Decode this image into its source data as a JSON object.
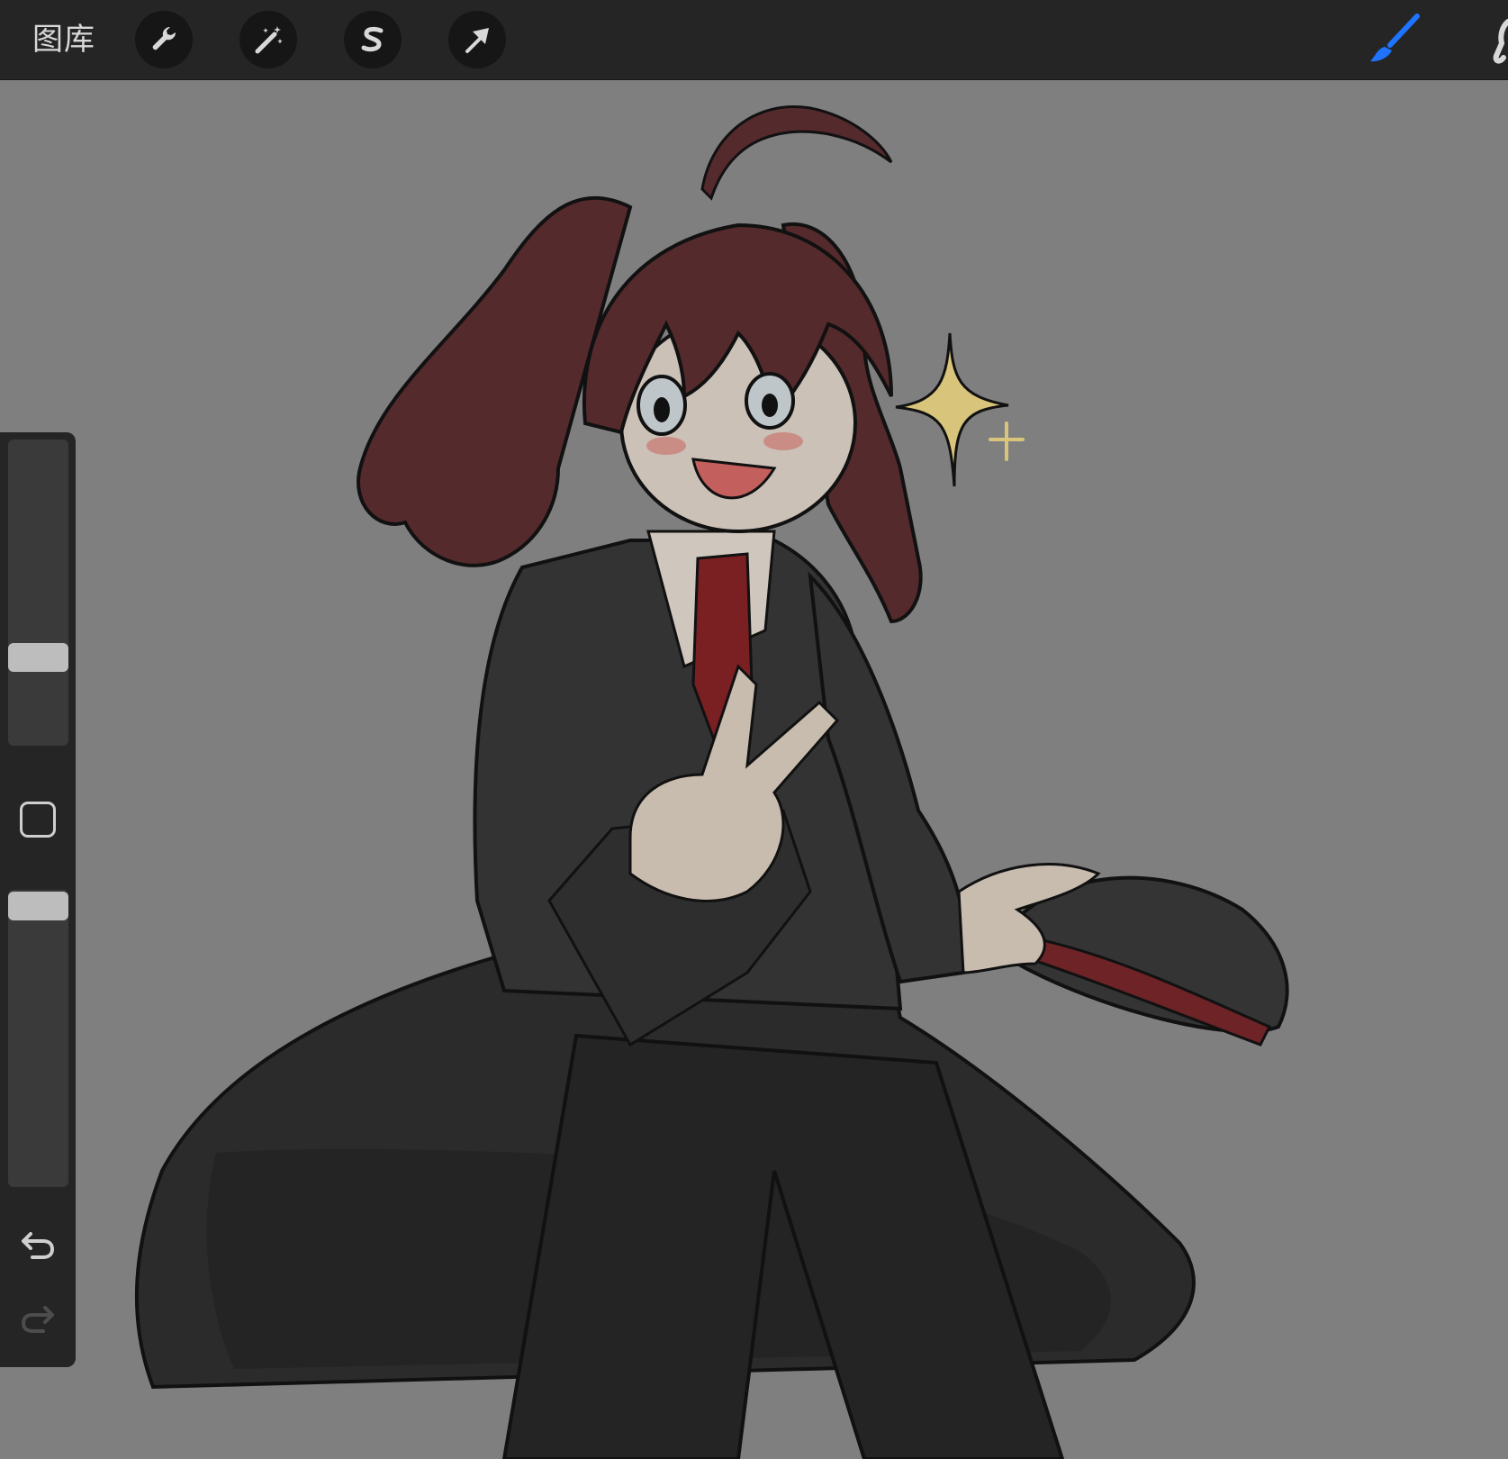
{
  "toolbar": {
    "gallery_label": "图库",
    "tools": [
      "actions",
      "adjustments",
      "selection",
      "transform"
    ],
    "active_tool": "brush",
    "active_color": "#1e74ff"
  },
  "sidebar": {
    "brush_size_level": 0.3,
    "brush_opacity_level": 1.0,
    "undo": "undo",
    "redo": "redo"
  },
  "canvas": {
    "background": "#7f7f7f",
    "artwork": "drawing"
  }
}
